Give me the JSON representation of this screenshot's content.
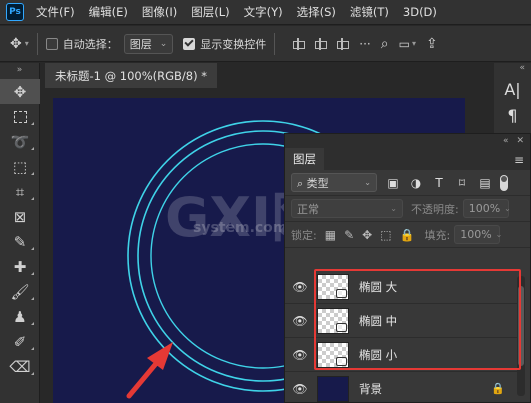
{
  "app": {
    "logo": "Ps"
  },
  "menu": [
    "文件(F)",
    "编辑(E)",
    "图像(I)",
    "图层(L)",
    "文字(Y)",
    "选择(S)",
    "滤镜(T)",
    "3D(D)"
  ],
  "options": {
    "auto_select_label": "自动选择：",
    "auto_select_checked": false,
    "target_value": "图层",
    "show_transform_label": "显示变换控件",
    "show_transform_checked": true
  },
  "document": {
    "tab_title": "未标题-1 @ 100%(RGB/8) *"
  },
  "watermark": {
    "main": "GXI网",
    "sub": "system.com"
  },
  "layers_panel": {
    "tab": "图层",
    "filter_kind": "类型",
    "blend_mode": "正常",
    "opacity_label": "不透明度:",
    "opacity_value": "100%",
    "lock_label": "锁定:",
    "fill_label": "填充:",
    "fill_value": "100%",
    "layers": [
      {
        "name": "椭圆 大",
        "visible": true
      },
      {
        "name": "椭圆 中",
        "visible": true
      },
      {
        "name": "椭圆 小",
        "visible": true
      },
      {
        "name": "背景",
        "visible": true,
        "locked": true
      }
    ]
  },
  "colors": {
    "canvas_bg": "#171a4b",
    "ring_color": "#3fd3e8",
    "highlight_red": "#e53935",
    "arrow_red": "#e53935",
    "ui_dark": "#323232",
    "panel_bg": "#383838"
  },
  "icons": {
    "move_tool": "move-icon",
    "marquee": "marquee-icon",
    "lasso": "lasso-icon",
    "crop": "crop-icon",
    "eyedropper": "eyedropper-icon",
    "brush": "brush-icon",
    "stamp": "stamp-icon",
    "eraser": "eraser-icon"
  }
}
